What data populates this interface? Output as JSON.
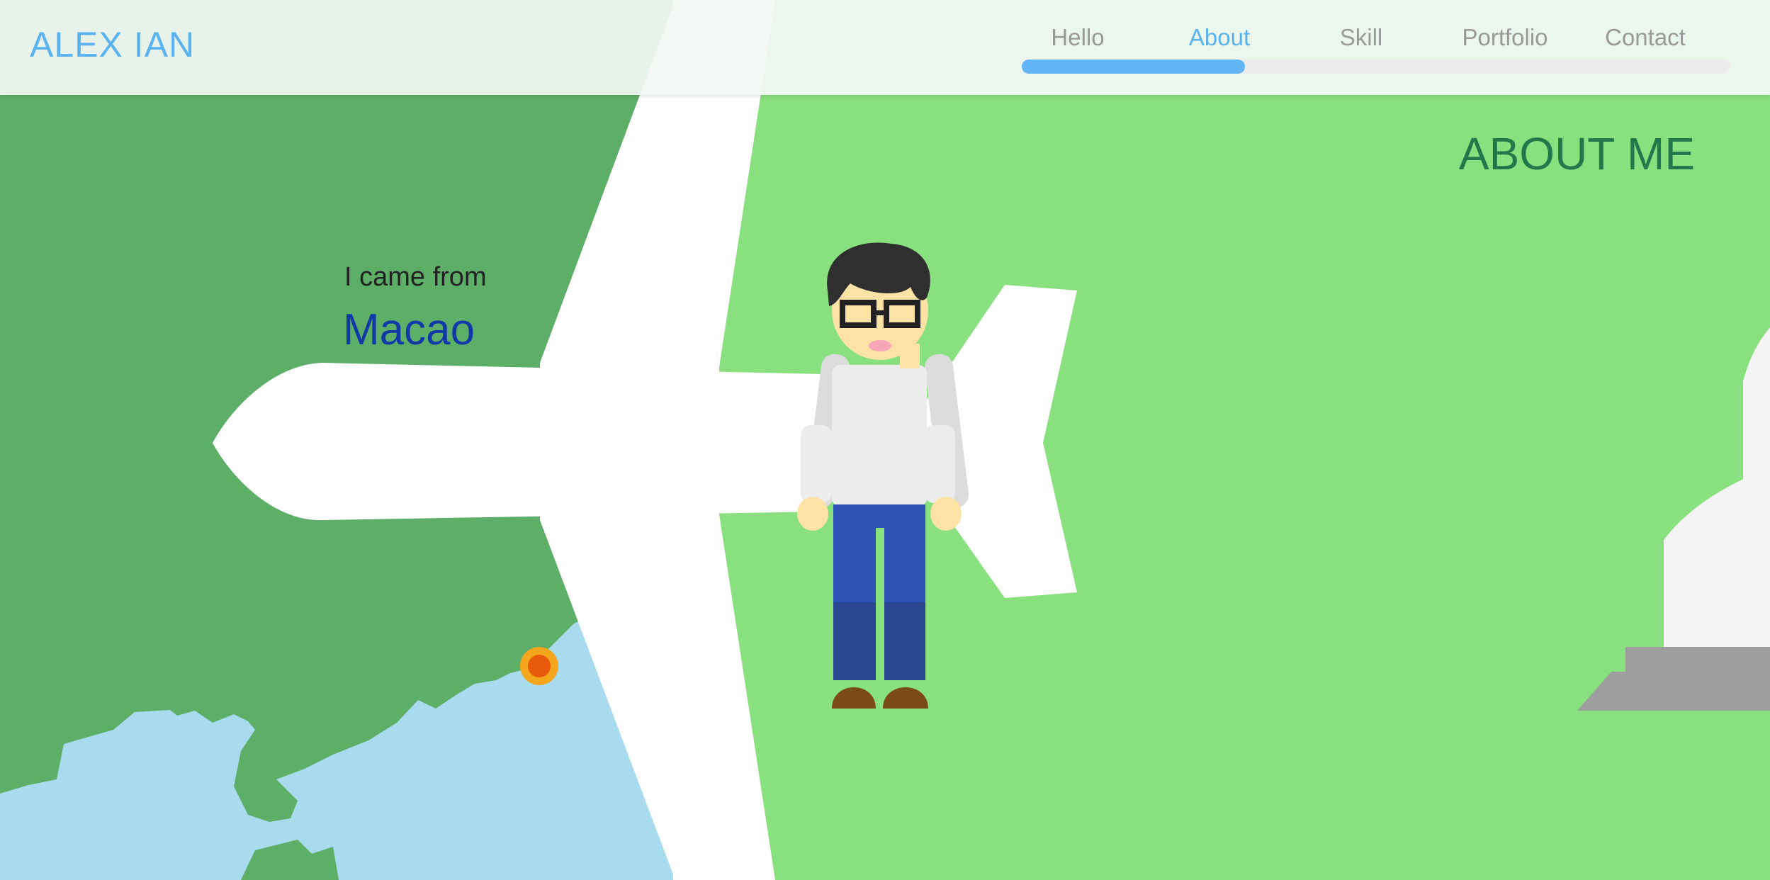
{
  "header": {
    "logo": "ALEX IAN",
    "nav": [
      {
        "label": "Hello",
        "active": false
      },
      {
        "label": "About",
        "active": true
      },
      {
        "label": "Skill",
        "active": false
      },
      {
        "label": "Portfolio",
        "active": false
      },
      {
        "label": "Contact",
        "active": false
      }
    ],
    "progress": 0.315
  },
  "main": {
    "title": "ABOUT ME",
    "origin_intro": "I came from",
    "origin_city": "Macao"
  },
  "colors": {
    "accent": "#5ab2ee",
    "progress": "#62b6f5",
    "land_dark": "#5daf68",
    "land_light": "#89e07e",
    "sea": "#a9dbee",
    "city_text": "#1039a8",
    "title_text": "#22784a",
    "location_marker": "#e85a0c"
  },
  "icons": [
    "airplane-icon",
    "map-pin-icon",
    "avatar-character",
    "church-illustration"
  ]
}
